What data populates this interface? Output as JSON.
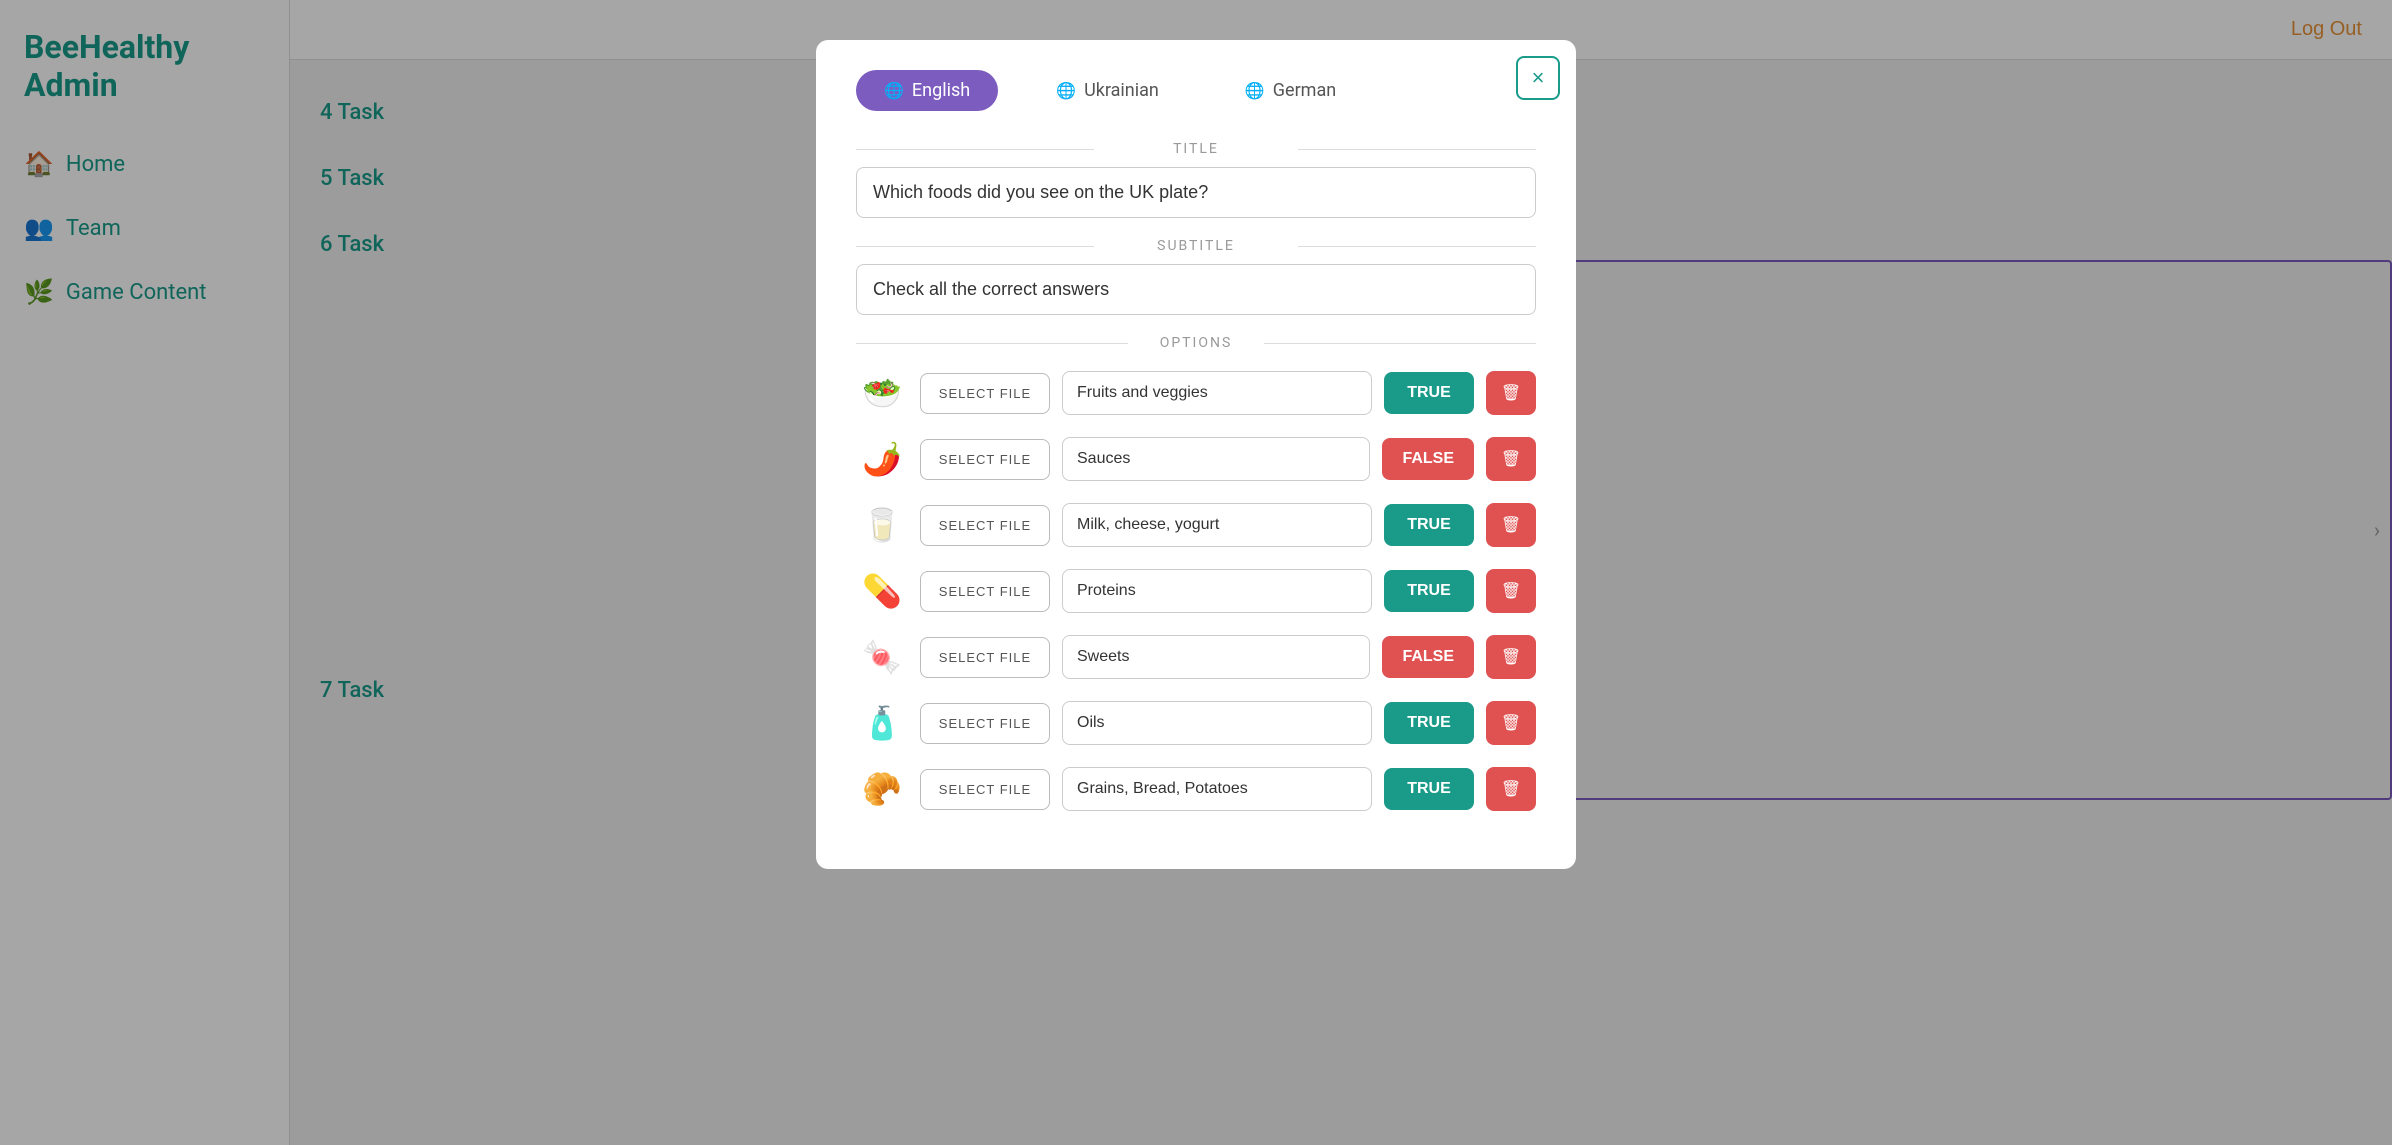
{
  "app": {
    "title": "BeeHealthy Admin",
    "logout_label": "Log Out"
  },
  "sidebar": {
    "items": [
      {
        "id": "home",
        "label": "Home",
        "icon": "🏠"
      },
      {
        "id": "team",
        "label": "Team",
        "icon": "👥"
      },
      {
        "id": "game-content",
        "label": "Game Content",
        "icon": "🌿"
      }
    ]
  },
  "tasks": [
    {
      "id": "task4",
      "label": "4 Task"
    },
    {
      "id": "task5",
      "label": "5 Task"
    },
    {
      "id": "task6",
      "label": "6 Task"
    },
    {
      "id": "task7",
      "label": "7 Task"
    }
  ],
  "modal": {
    "close_label": "×",
    "languages": [
      {
        "id": "english",
        "label": "English",
        "flag": "🌐",
        "active": true
      },
      {
        "id": "ukrainian",
        "label": "Ukrainian",
        "flag": "🌐",
        "active": false
      },
      {
        "id": "german",
        "label": "German",
        "flag": "🌐",
        "active": false
      }
    ],
    "title_label": "TITLE",
    "title_value": "Which foods did you see on the UK plate?",
    "subtitle_label": "SUBTITLE",
    "subtitle_value": "Check all the correct answers",
    "options_label": "OPTIONS",
    "options": [
      {
        "id": 1,
        "icon": "🥗",
        "text": "Fruits and veggies",
        "answer": "TRUE",
        "is_true": true
      },
      {
        "id": 2,
        "icon": "🌶️",
        "text": "Sauces",
        "answer": "FALSE",
        "is_true": false
      },
      {
        "id": 3,
        "icon": "🥛",
        "text": "Milk, cheese, yogurt",
        "answer": "TRUE",
        "is_true": true
      },
      {
        "id": 4,
        "icon": "💊",
        "text": "Proteins",
        "answer": "TRUE",
        "is_true": true
      },
      {
        "id": 5,
        "icon": "🍬",
        "text": "Sweets",
        "answer": "FALSE",
        "is_true": false
      },
      {
        "id": 6,
        "icon": "🧴",
        "text": "Oils",
        "answer": "TRUE",
        "is_true": true
      },
      {
        "id": 7,
        "icon": "🥐",
        "text": "Grains, Bread, Potatoes",
        "answer": "TRUE",
        "is_true": true
      }
    ],
    "select_file_label": "SELECT FILE"
  }
}
